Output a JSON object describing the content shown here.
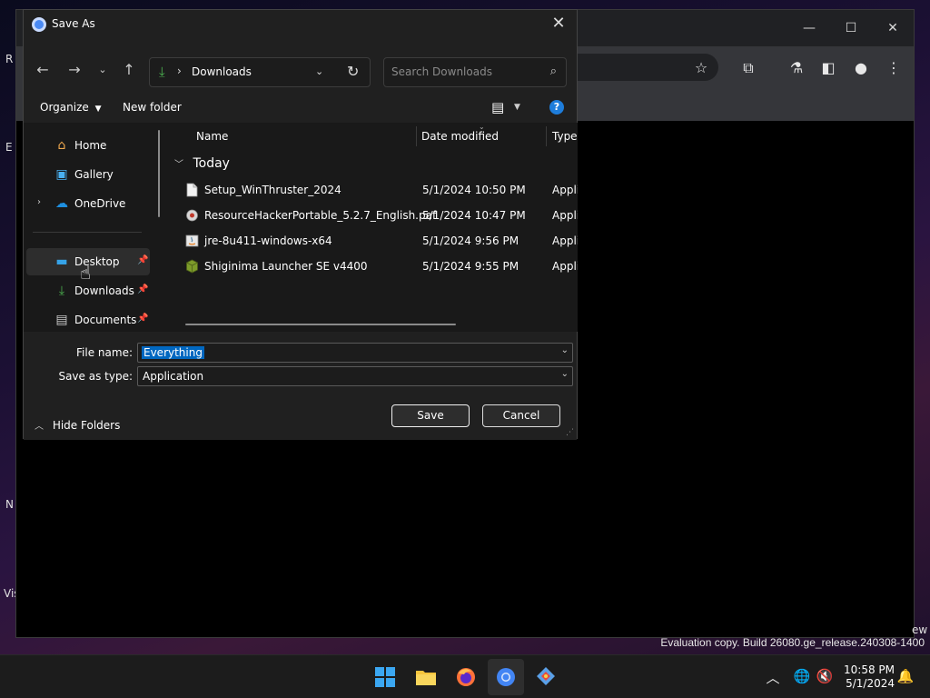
{
  "dialog": {
    "title": "Save As",
    "address": {
      "path": "Downloads"
    },
    "search": {
      "placeholder": "Search Downloads"
    },
    "commands": {
      "organize": "Organize",
      "new_folder": "New folder"
    },
    "nav_items": [
      {
        "label": "Home",
        "icon": "home-icon"
      },
      {
        "label": "Gallery",
        "icon": "gallery-icon"
      },
      {
        "label": "OneDrive",
        "icon": "cloud-icon"
      },
      {
        "label": "Desktop",
        "icon": "desktop-icon"
      },
      {
        "label": "Downloads",
        "icon": "download-icon"
      },
      {
        "label": "Documents",
        "icon": "document-icon"
      }
    ],
    "columns": {
      "name": "Name",
      "date": "Date modified",
      "type": "Type"
    },
    "group": "Today",
    "files": [
      {
        "name": "Setup_WinThruster_2024",
        "date": "5/1/2024 10:50 PM",
        "type": "Appli",
        "icon": "file-icon"
      },
      {
        "name": "ResourceHackerPortable_5.2.7_English.paf",
        "date": "5/1/2024 10:47 PM",
        "type": "Appli",
        "icon": "installer-icon"
      },
      {
        "name": "jre-8u411-windows-x64",
        "date": "5/1/2024 9:56 PM",
        "type": "Appli",
        "icon": "java-icon"
      },
      {
        "name": "Shiginima Launcher SE v4400",
        "date": "5/1/2024 9:55 PM",
        "type": "Appli",
        "icon": "minecraft-icon"
      }
    ],
    "file_name_label": "File name:",
    "file_name_value": "Everything",
    "save_type_label": "Save as type:",
    "save_type_value": "Application",
    "hide_folders": "Hide Folders",
    "save_button": "Save",
    "cancel_button": "Cancel"
  },
  "desktop": {
    "evaluation_text": "Evaluation copy. Build 26080.ge_release.240308-1400",
    "edge_fragments": [
      "R",
      "E",
      "N",
      "Vis",
      "ew"
    ]
  },
  "taskbar": {
    "time": "10:58 PM",
    "date": "5/1/2024"
  }
}
